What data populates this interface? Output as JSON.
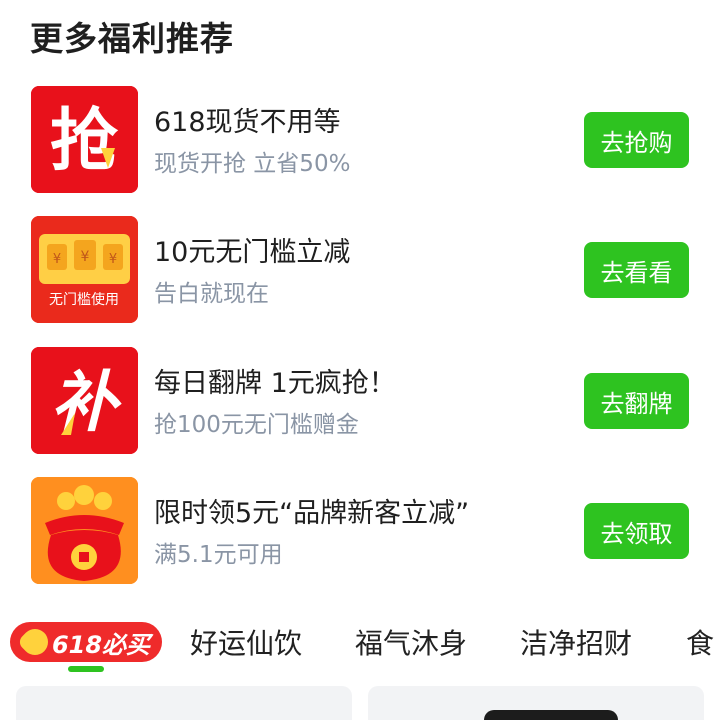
{
  "section": {
    "title": "更多福利推荐"
  },
  "offers": [
    {
      "title": "618现货不用等",
      "subtitle": "现货开抢 立省50%",
      "cta": "去抢购",
      "icon_text": "抢",
      "icon": "qiang-icon"
    },
    {
      "title": "10元无门槛立减",
      "subtitle": "告白就现在",
      "cta": "去看看",
      "icon_text": "无门槛使用",
      "icon": "coupon-icon"
    },
    {
      "title": "每日翻牌 1元疯抢！",
      "subtitle": "抢100元无门槛赠金",
      "cta": "去翻牌",
      "icon_text": "补",
      "icon": "bu-icon"
    },
    {
      "title": "限时领5元“品牌新客立减”",
      "subtitle": "满5.1元可用",
      "cta": "去领取",
      "icon": "lucky-bag-icon"
    }
  ],
  "tabs": {
    "badge": "618必买",
    "items": [
      "好运仙饮",
      "福气沐身",
      "洁净招财",
      "食"
    ]
  },
  "colors": {
    "cta_green": "#2ec320",
    "subtitle_gray": "#8a95a5",
    "badge_red": "#ef2b2b"
  }
}
